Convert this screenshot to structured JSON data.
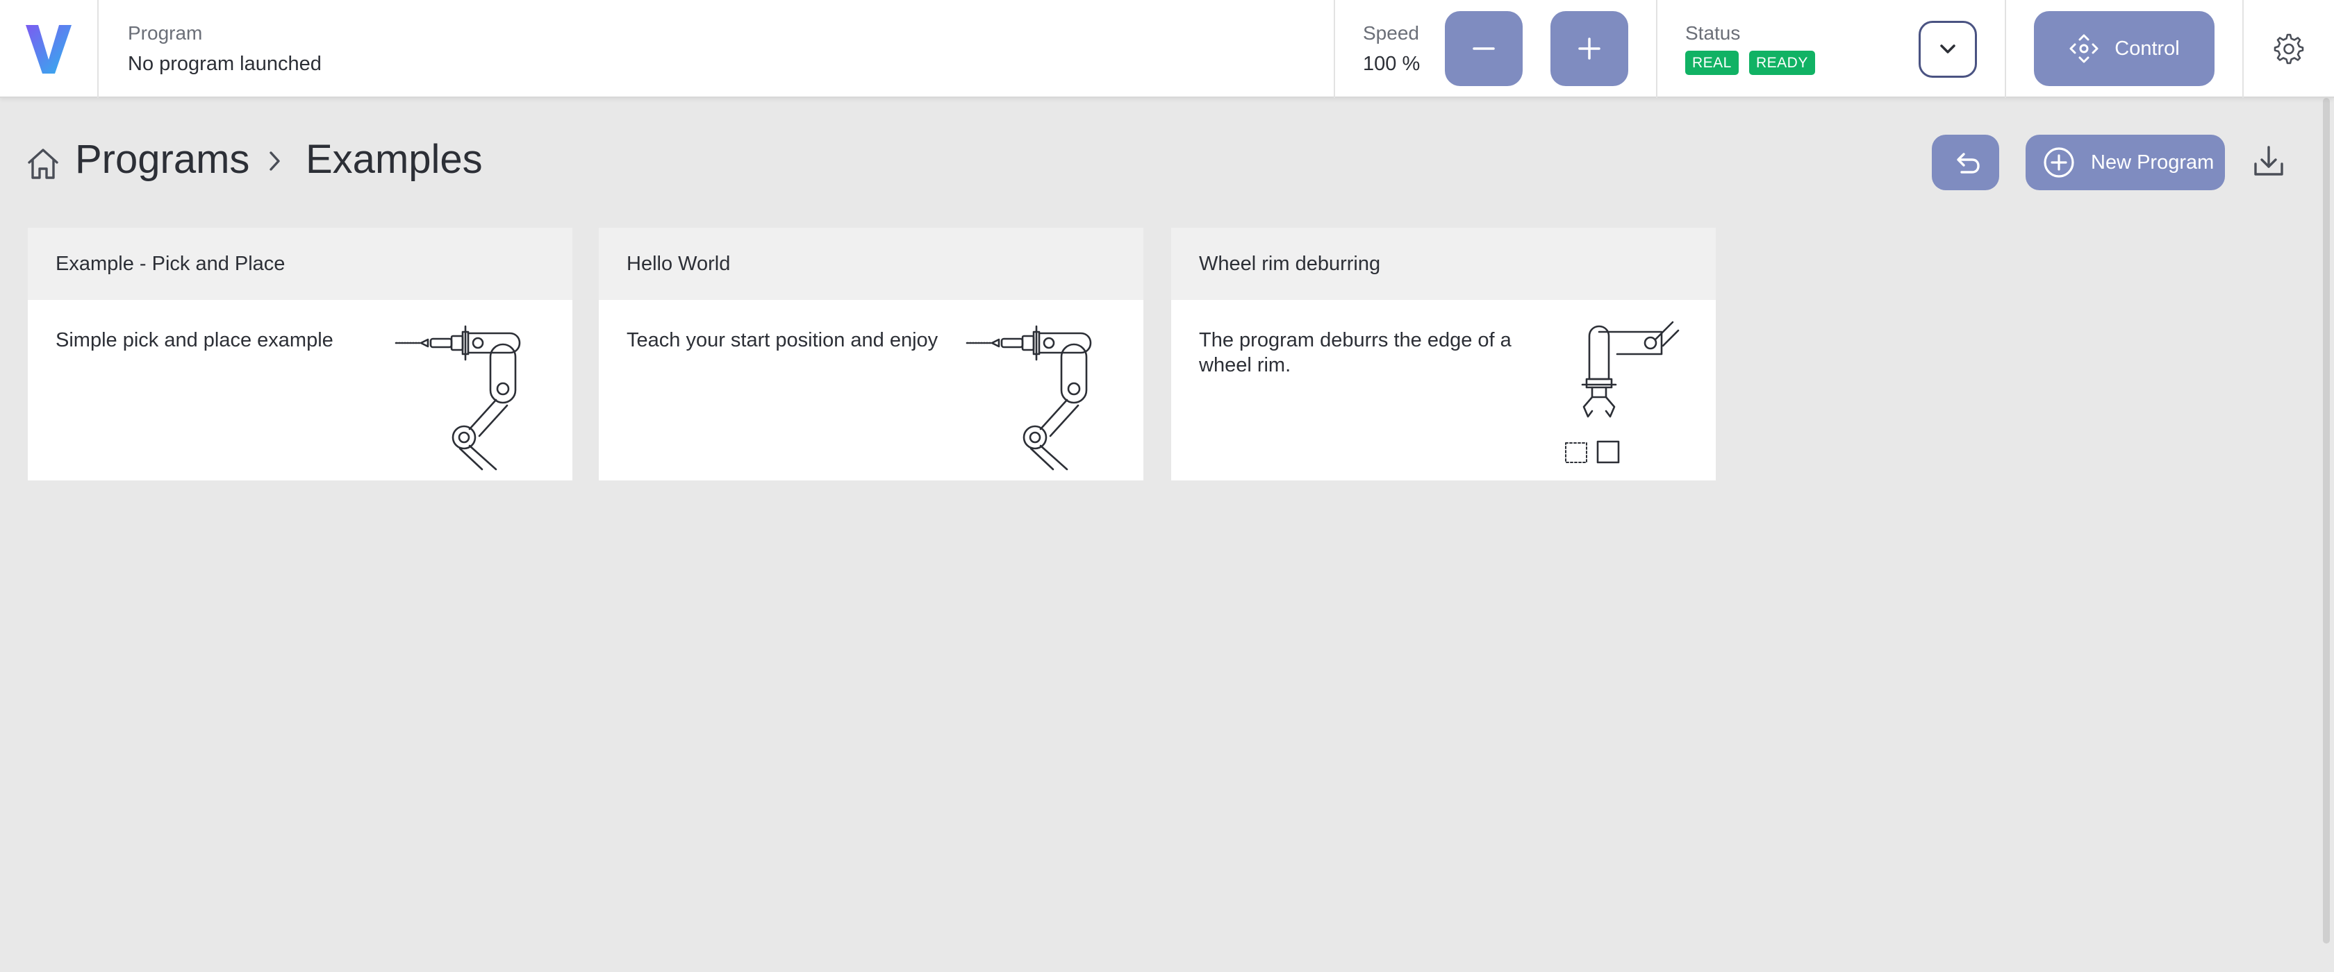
{
  "header": {
    "logo_letter": "V",
    "program_label": "Program",
    "program_value": "No program launched",
    "speed_label": "Speed",
    "speed_value": "100 %",
    "status_label": "Status",
    "status_badges": [
      "REAL",
      "READY"
    ],
    "control_label": "Control"
  },
  "breadcrumb": {
    "root": "Programs",
    "current": "Examples"
  },
  "toolbar": {
    "new_program_label": "New Program"
  },
  "cards": [
    {
      "title": "Example - Pick and Place",
      "description": "Simple pick and place example",
      "illustration": "robot-arm-icon"
    },
    {
      "title": "Hello World",
      "description": "Teach your start position and enjoy",
      "illustration": "robot-arm-icon"
    },
    {
      "title": "Wheel rim deburring",
      "description": "The program deburrs the edge of a wheel rim.",
      "illustration": "robot-gripper-icon"
    }
  ],
  "colors": {
    "accent": "#7f8cc0",
    "status_green": "#11b264",
    "background": "#e8e8e8",
    "logo_gradient": [
      "#7b5cf0",
      "#2fb3ee"
    ]
  }
}
